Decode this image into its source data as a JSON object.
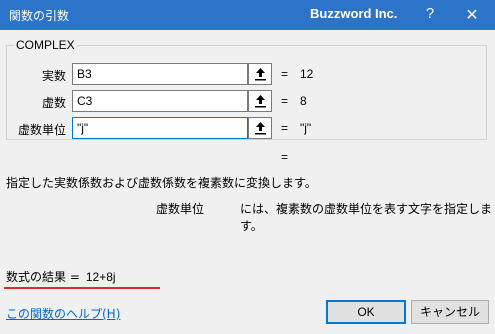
{
  "window": {
    "title": "関数の引数",
    "brand": "Buzzword Inc.",
    "help_glyph": "?",
    "close_glyph": "✕",
    "colors": {
      "titlebar": "#2b74c9",
      "dialog_bg": "#f0f0f0",
      "link": "#0066cc",
      "underline_accent": "#e32b2b"
    }
  },
  "function": {
    "name": "COMPLEX",
    "args": [
      {
        "label": "実数",
        "input": "B3",
        "equals": "=",
        "value": "12"
      },
      {
        "label": "虚数",
        "input": "C3",
        "equals": "=",
        "value": "8"
      },
      {
        "label": "虚数単位",
        "input": "\"j\"",
        "equals": "=",
        "value": "\"j\""
      }
    ],
    "result_equals": "=",
    "description": "指定した実数係数および虚数係数を複素数に変換します。",
    "arg_description_name": "虚数単位",
    "arg_description_text": "には、複素数の虚数単位を表す文字を指定します。"
  },
  "footer": {
    "formula_result_label": "数式の結果 =",
    "formula_result_value": "12+8j",
    "help_link": "この関数のヘルプ(H)",
    "ok_label": "OK",
    "cancel_label": "キャンセル"
  },
  "icons": {
    "collapse": "collapse-dialog-icon"
  }
}
